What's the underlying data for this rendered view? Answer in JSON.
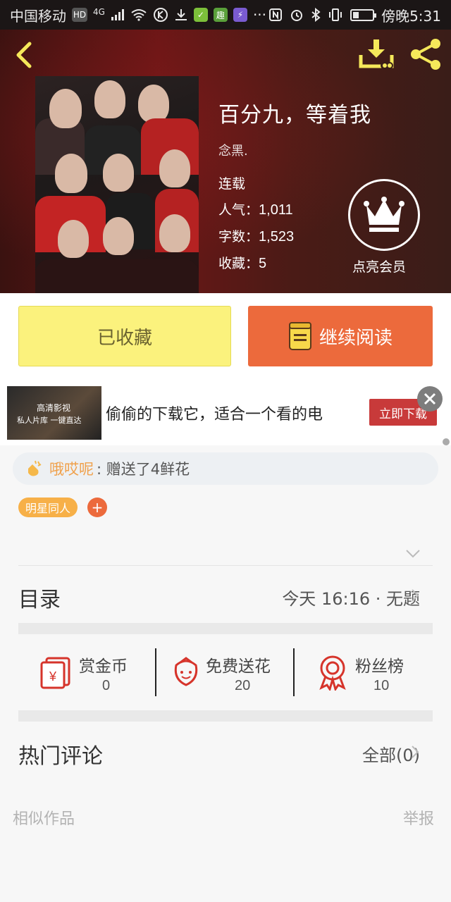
{
  "status_bar": {
    "carrier": "中国移动",
    "hd": "HD",
    "network": "4G",
    "time": "傍晚5:31",
    "more": "···",
    "icons": [
      "signal-icon",
      "wifi-icon",
      "k-icon",
      "download-icon",
      "app-green-icon",
      "app-qu-icon",
      "app-purple-icon",
      "nfc-icon",
      "alarm-icon",
      "bluetooth-icon",
      "vibrate-icon",
      "battery-icon"
    ]
  },
  "book": {
    "title": "百分九，等着我",
    "author": "念黑.",
    "status": "连载",
    "popularity_label": "人气：",
    "popularity": "1,011",
    "words_label": "字数：",
    "words": "1,523",
    "favorites_label": "收藏：",
    "favorites": "5",
    "vip_label": "点亮会员"
  },
  "actions": {
    "favorited_label": "已收藏",
    "continue_label": "继续阅读"
  },
  "ad": {
    "thumb_line1": "高清影视",
    "thumb_line2": "私人片库 一键直达",
    "text": "偷偷的下载它，适合一个看的电",
    "cta": "立即下载"
  },
  "gift_notice": {
    "user": "哦哎呢",
    "message": ": 赠送了4鲜花"
  },
  "tag": {
    "label": "明星同人",
    "add": "+"
  },
  "catalog": {
    "title": "目录",
    "latest": "今天 16:16 · 无题"
  },
  "stats": [
    {
      "label": "赏金币",
      "value": "0",
      "icon": "red-envelope-icon"
    },
    {
      "label": "免费送花",
      "value": "20",
      "icon": "flower-icon"
    },
    {
      "label": "粉丝榜",
      "value": "10",
      "icon": "medal-icon"
    }
  ],
  "comments": {
    "title": "热门评论",
    "all": "全部(0)"
  },
  "footer": {
    "similar": "相似作品",
    "report": "举报"
  },
  "colors": {
    "accent_orange": "#ec6a3c",
    "fav_yellow": "#fbf27d",
    "icon_yellow": "#f5e85a",
    "tag_orange": "#f7b048",
    "stat_red": "#d6342b"
  }
}
